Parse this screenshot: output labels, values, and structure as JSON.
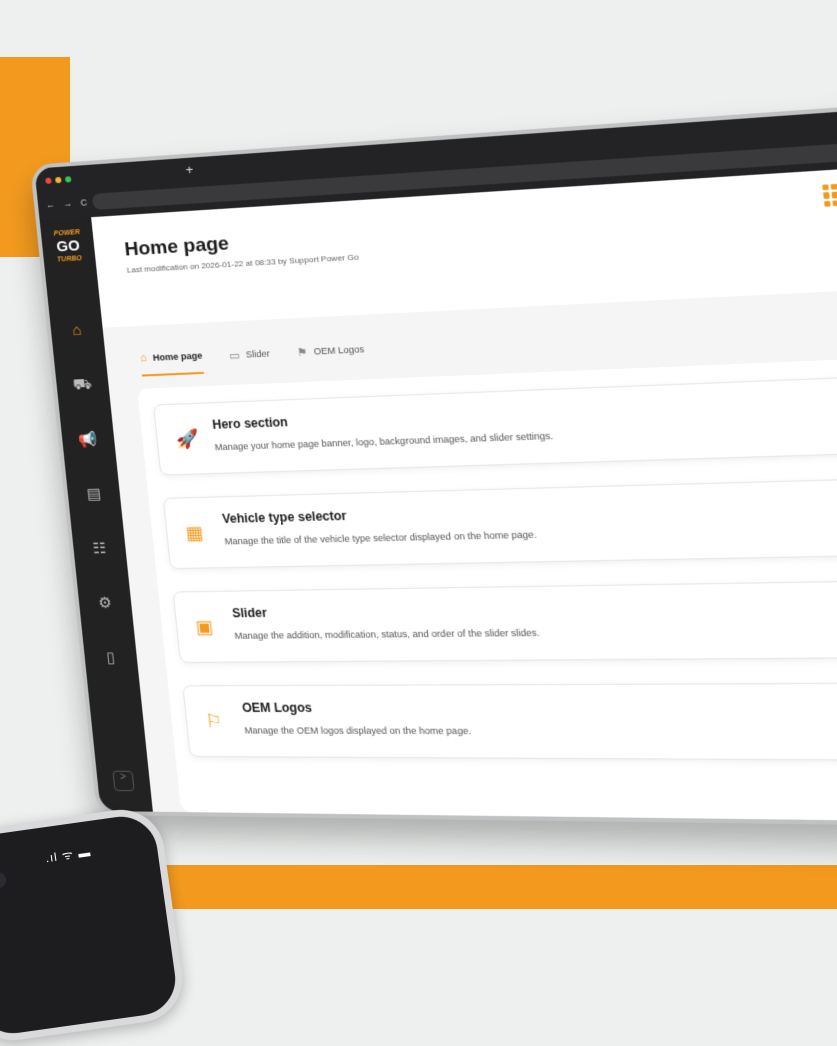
{
  "browser": {
    "new_tab": "+",
    "nav": "← → C"
  },
  "brand": {
    "line1": "POWER",
    "line2": "GO",
    "line3": "TURBO"
  },
  "sidebar": {
    "items": [
      {
        "icon": "home-icon",
        "glyph": "⌂"
      },
      {
        "icon": "vehicles-icon",
        "glyph": "⛟"
      },
      {
        "icon": "megaphone-icon",
        "glyph": "📢"
      },
      {
        "icon": "document-icon",
        "glyph": "▤"
      },
      {
        "icon": "users-icon",
        "glyph": "☷"
      },
      {
        "icon": "motorcycle-icon",
        "glyph": "⚙"
      },
      {
        "icon": "file-icon",
        "glyph": "▯"
      }
    ],
    "collapse": ">"
  },
  "header": {
    "title": "Home page",
    "subtitle": "Last modification on 2026-01-22 at 08:33 by Support Power Go"
  },
  "tabs": [
    {
      "label": "Home page",
      "glyph": "⌂"
    },
    {
      "label": "Slider",
      "glyph": "▭"
    },
    {
      "label": "OEM Logos",
      "glyph": "⚑"
    }
  ],
  "cards": [
    {
      "title": "Hero section",
      "desc": "Manage your home page banner, logo, background images, and slider settings.",
      "icon": "rocket-icon",
      "glyph": "🚀"
    },
    {
      "title": "Vehicle type selector",
      "desc": "Manage the title of the vehicle type selector displayed on the home page.",
      "icon": "grid-blocks-icon",
      "glyph": "▦"
    },
    {
      "title": "Slider",
      "desc": "Manage the addition, modification, status, and order of the slider slides.",
      "icon": "image-icon",
      "glyph": "▣"
    },
    {
      "title": "OEM Logos",
      "desc": "Manage the OEM logos displayed on the home page.",
      "icon": "flag-icon",
      "glyph": "⚐"
    }
  ],
  "chevron": "›",
  "phone": {
    "status": ".ıl ᯤ ▬"
  },
  "colors": {
    "accent": "#f39a1e",
    "sidebar": "#222222"
  }
}
